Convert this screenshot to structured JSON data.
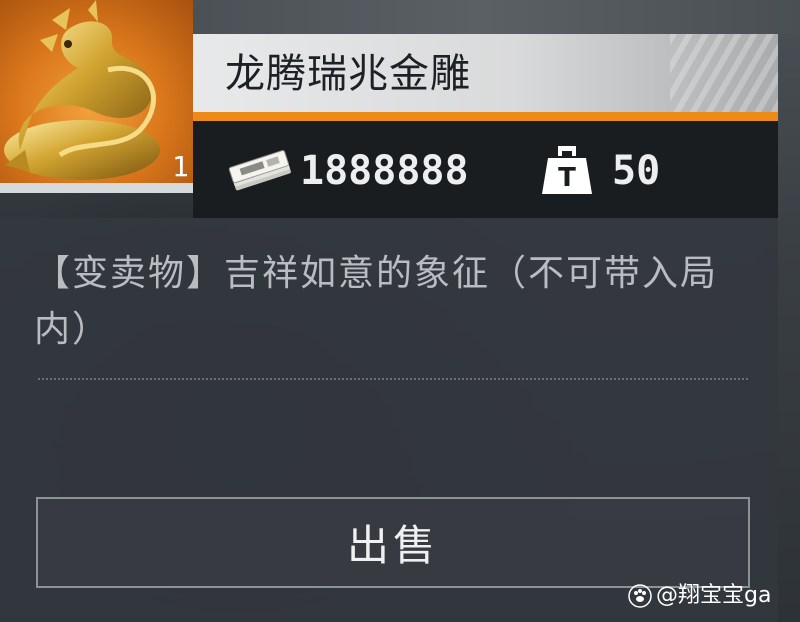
{
  "item": {
    "name": "龙腾瑞兆金雕",
    "count": "1",
    "price": "1888888",
    "weight": "50",
    "description": "【变卖物】吉祥如意的象征（不可带入局内）"
  },
  "actions": {
    "sell_label": "出售"
  },
  "watermark": {
    "text": "@翔宝宝ga"
  },
  "icons": {
    "item": "golden-dragon-icon",
    "price": "money-bills-icon",
    "weight": "weight-icon",
    "watermark": "paw-icon"
  },
  "colors": {
    "accent": "#ec8b18",
    "tile_orange": "#d9761b",
    "panel": "#34383e",
    "stats_bar": "#1a1d20"
  }
}
